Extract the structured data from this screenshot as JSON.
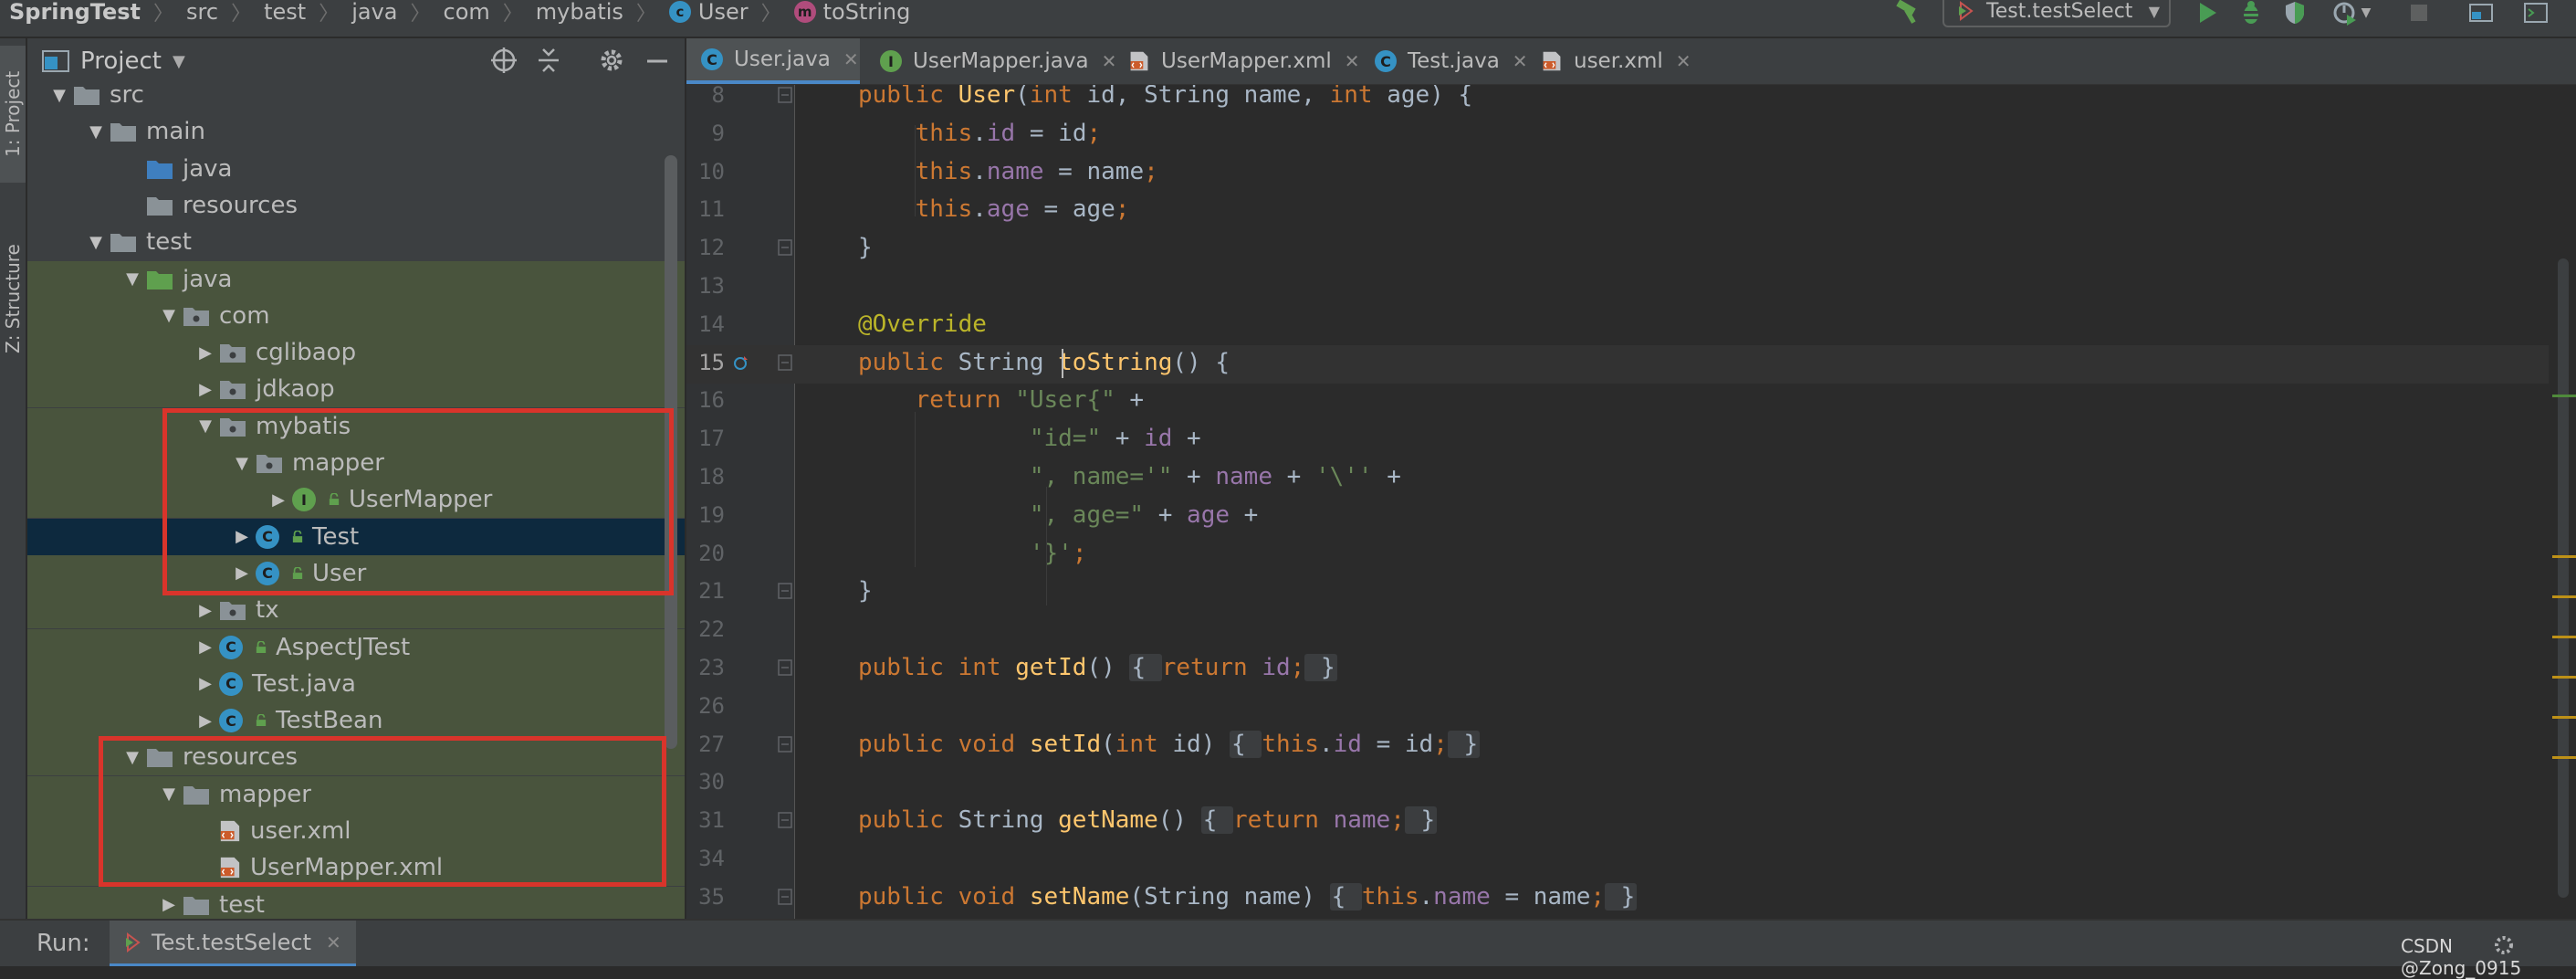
{
  "breadcrumbs": [
    "SpringTest",
    "src",
    "test",
    "java",
    "com",
    "mybatis",
    "User",
    "toString"
  ],
  "run_config": {
    "label": "Test.testSelect"
  },
  "left_strip": {
    "project_tab": "1: Project",
    "structure_tab": "Z: Structure"
  },
  "project_panel": {
    "title": "Project"
  },
  "tree": [
    {
      "label": "src",
      "depth": 0,
      "expanded": true,
      "icon": "folder"
    },
    {
      "label": "main",
      "depth": 1,
      "expanded": true,
      "icon": "folder"
    },
    {
      "label": "java",
      "depth": 2,
      "expanded": null,
      "icon": "folder-source"
    },
    {
      "label": "resources",
      "depth": 2,
      "expanded": null,
      "icon": "folder-resources"
    },
    {
      "label": "test",
      "depth": 1,
      "expanded": true,
      "icon": "folder"
    },
    {
      "label": "java",
      "depth": 2,
      "expanded": true,
      "icon": "folder-test"
    },
    {
      "label": "com",
      "depth": 3,
      "expanded": true,
      "icon": "package"
    },
    {
      "label": "cglibaop",
      "depth": 4,
      "expanded": false,
      "icon": "package"
    },
    {
      "label": "jdkaop",
      "depth": 4,
      "expanded": false,
      "icon": "package"
    },
    {
      "label": "mybatis",
      "depth": 4,
      "expanded": true,
      "icon": "package"
    },
    {
      "label": "mapper",
      "depth": 5,
      "expanded": true,
      "icon": "package"
    },
    {
      "label": "UserMapper",
      "depth": 6,
      "expanded": false,
      "icon": "interface"
    },
    {
      "label": "Test",
      "depth": 5,
      "expanded": false,
      "icon": "class-test"
    },
    {
      "label": "User",
      "depth": 5,
      "expanded": false,
      "icon": "class"
    },
    {
      "label": "tx",
      "depth": 4,
      "expanded": false,
      "icon": "package"
    },
    {
      "label": "AspectJTest",
      "depth": 4,
      "expanded": false,
      "icon": "class"
    },
    {
      "label": "Test.java",
      "depth": 4,
      "expanded": false,
      "icon": "class-plain"
    },
    {
      "label": "TestBean",
      "depth": 4,
      "expanded": false,
      "icon": "class"
    },
    {
      "label": "resources",
      "depth": 2,
      "expanded": true,
      "icon": "folder-test-resources"
    },
    {
      "label": "mapper",
      "depth": 3,
      "expanded": true,
      "icon": "folder"
    },
    {
      "label": "user.xml",
      "depth": 4,
      "expanded": null,
      "icon": "xml"
    },
    {
      "label": "UserMapper.xml",
      "depth": 4,
      "expanded": null,
      "icon": "xml"
    },
    {
      "label": "test",
      "depth": 3,
      "expanded": false,
      "icon": "folder"
    }
  ],
  "tabs": [
    {
      "label": "User.java",
      "icon": "class",
      "active": true
    },
    {
      "label": "UserMapper.java",
      "icon": "interface",
      "active": false
    },
    {
      "label": "UserMapper.xml",
      "icon": "xml",
      "active": false
    },
    {
      "label": "Test.java",
      "icon": "class",
      "active": false
    },
    {
      "label": "user.xml",
      "icon": "xml",
      "active": false
    }
  ],
  "code_lines": [
    {
      "num": "8",
      "tokens": [
        [
          "kw",
          "public "
        ],
        [
          "fn",
          "User"
        ],
        [
          "def",
          "("
        ],
        [
          "kw",
          "int "
        ],
        [
          "def",
          "id, String name, "
        ],
        [
          "kw",
          "int "
        ],
        [
          "def",
          "age) {"
        ]
      ]
    },
    {
      "num": "9",
      "tokens": [
        [
          "def",
          "    "
        ],
        [
          "kw",
          "this"
        ],
        [
          "def",
          "."
        ],
        [
          "fld",
          "id"
        ],
        [
          "def",
          " = id"
        ],
        [
          "kw",
          ";"
        ]
      ]
    },
    {
      "num": "10",
      "tokens": [
        [
          "def",
          "    "
        ],
        [
          "kw",
          "this"
        ],
        [
          "def",
          "."
        ],
        [
          "fld",
          "name"
        ],
        [
          "def",
          " = name"
        ],
        [
          "kw",
          ";"
        ]
      ]
    },
    {
      "num": "11",
      "tokens": [
        [
          "def",
          "    "
        ],
        [
          "kw",
          "this"
        ],
        [
          "def",
          "."
        ],
        [
          "fld",
          "age"
        ],
        [
          "def",
          " = age"
        ],
        [
          "kw",
          ";"
        ]
      ]
    },
    {
      "num": "12",
      "tokens": [
        [
          "def",
          "}"
        ]
      ]
    },
    {
      "num": "13",
      "tokens": []
    },
    {
      "num": "14",
      "tokens": [
        [
          "ann",
          "@Override"
        ]
      ]
    },
    {
      "num": "15",
      "tokens": [
        [
          "kw",
          "public "
        ],
        [
          "def",
          "String "
        ],
        [
          "fn",
          "toString"
        ],
        [
          "def",
          "() {"
        ]
      ]
    },
    {
      "num": "16",
      "tokens": [
        [
          "def",
          "    "
        ],
        [
          "kw",
          "return "
        ],
        [
          "str",
          "\"User{\""
        ],
        [
          "def",
          " +"
        ]
      ]
    },
    {
      "num": "17",
      "tokens": [
        [
          "def",
          "            "
        ],
        [
          "str",
          "\"id=\""
        ],
        [
          "def",
          " + "
        ],
        [
          "fld",
          "id"
        ],
        [
          "def",
          " +"
        ]
      ]
    },
    {
      "num": "18",
      "tokens": [
        [
          "def",
          "            "
        ],
        [
          "str",
          "\", name='\""
        ],
        [
          "def",
          " + "
        ],
        [
          "fld",
          "name"
        ],
        [
          "def",
          " + "
        ],
        [
          "str",
          "'\\''"
        ],
        [
          "def",
          " +"
        ]
      ]
    },
    {
      "num": "19",
      "tokens": [
        [
          "def",
          "            "
        ],
        [
          "str",
          "\", age=\""
        ],
        [
          "def",
          " + "
        ],
        [
          "fld",
          "age"
        ],
        [
          "def",
          " +"
        ]
      ]
    },
    {
      "num": "20",
      "tokens": [
        [
          "def",
          "            "
        ],
        [
          "str",
          "'}'"
        ],
        [
          "kw",
          ";"
        ]
      ]
    },
    {
      "num": "21",
      "tokens": [
        [
          "def",
          "}"
        ]
      ]
    },
    {
      "num": "22",
      "tokens": []
    },
    {
      "num": "23",
      "tokens": [
        [
          "kw",
          "public int "
        ],
        [
          "fn",
          "getId"
        ],
        [
          "def",
          "() "
        ],
        [
          "fold",
          "{ "
        ],
        [
          "kw",
          "return "
        ],
        [
          "fld",
          "id"
        ],
        [
          "kw",
          ";"
        ],
        [
          "fold",
          " }"
        ]
      ]
    },
    {
      "num": "26",
      "tokens": []
    },
    {
      "num": "27",
      "tokens": [
        [
          "kw",
          "public void "
        ],
        [
          "fn",
          "setId"
        ],
        [
          "def",
          "("
        ],
        [
          "kw",
          "int "
        ],
        [
          "def",
          "id) "
        ],
        [
          "fold",
          "{ "
        ],
        [
          "kw",
          "this"
        ],
        [
          "def",
          "."
        ],
        [
          "fld",
          "id"
        ],
        [
          "def",
          " = id"
        ],
        [
          "kw",
          ";"
        ],
        [
          "fold",
          " }"
        ]
      ]
    },
    {
      "num": "30",
      "tokens": []
    },
    {
      "num": "31",
      "tokens": [
        [
          "kw",
          "public "
        ],
        [
          "def",
          "String "
        ],
        [
          "fn",
          "getName"
        ],
        [
          "def",
          "() "
        ],
        [
          "fold",
          "{ "
        ],
        [
          "kw",
          "return "
        ],
        [
          "fld",
          "name"
        ],
        [
          "kw",
          ";"
        ],
        [
          "fold",
          " }"
        ]
      ]
    },
    {
      "num": "34",
      "tokens": []
    },
    {
      "num": "35",
      "tokens": [
        [
          "kw",
          "public void "
        ],
        [
          "fn",
          "setName"
        ],
        [
          "def",
          "(String name) "
        ],
        [
          "fold",
          "{ "
        ],
        [
          "kw",
          "this"
        ],
        [
          "def",
          "."
        ],
        [
          "fld",
          "name"
        ],
        [
          "def",
          " = name"
        ],
        [
          "kw",
          ";"
        ],
        [
          "fold",
          " }"
        ]
      ]
    }
  ],
  "current_line": "15",
  "run_bar": {
    "label": "Run:",
    "tab": "Test.testSelect"
  },
  "watermark": "CSDN @Zong_0915",
  "colors": {
    "keyword": "#cc7832",
    "field": "#9876aa",
    "string": "#6a8759",
    "annotation": "#bbb529",
    "method": "#ffc66d",
    "default": "#a9b7c6",
    "highlight_box": "#d9342b",
    "selection": "#0d293e",
    "test_tint": "#49543d"
  }
}
